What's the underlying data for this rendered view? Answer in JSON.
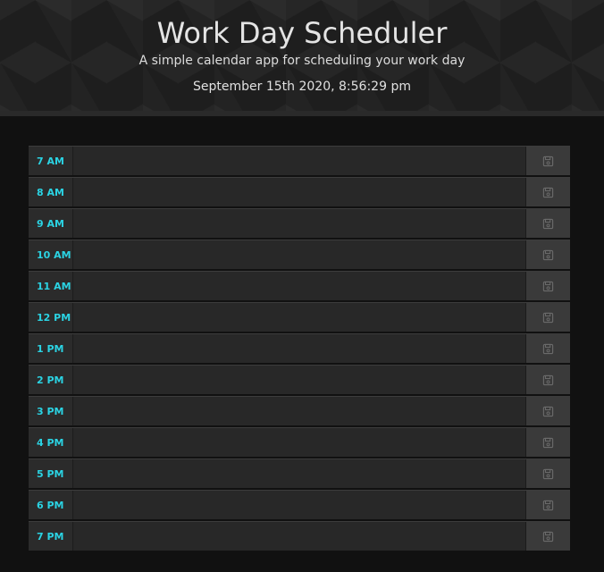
{
  "header": {
    "title": "Work Day Scheduler",
    "subtitle": "A simple calendar app for scheduling your work day",
    "current_day": "September 15th 2020, 8:56:29 pm"
  },
  "colors": {
    "hour_label": "#2bd3e3",
    "background": "#111111",
    "row_background": "#282828",
    "save_button": "#3a3a3a"
  },
  "save_icon": "floppy-disk-icon",
  "time_blocks": [
    {
      "hour": "7 AM",
      "text": ""
    },
    {
      "hour": "8 AM",
      "text": ""
    },
    {
      "hour": "9 AM",
      "text": ""
    },
    {
      "hour": "10 AM",
      "text": ""
    },
    {
      "hour": "11 AM",
      "text": ""
    },
    {
      "hour": "12 PM",
      "text": ""
    },
    {
      "hour": "1 PM",
      "text": ""
    },
    {
      "hour": "2 PM",
      "text": ""
    },
    {
      "hour": "3 PM",
      "text": ""
    },
    {
      "hour": "4 PM",
      "text": ""
    },
    {
      "hour": "5 PM",
      "text": ""
    },
    {
      "hour": "6 PM",
      "text": ""
    },
    {
      "hour": "7 PM",
      "text": ""
    }
  ]
}
